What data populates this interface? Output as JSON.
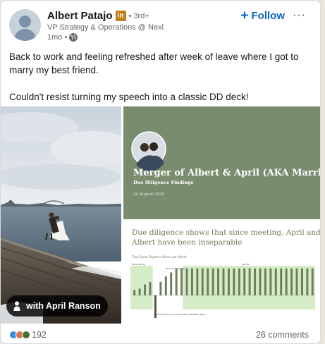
{
  "author": {
    "name": "Albert Patajo",
    "badge": "in",
    "degree": "• 3rd+",
    "headline": "VP Strategy & Operations @ Nexl",
    "time": "1mo •"
  },
  "actions": {
    "follow_label": "Follow",
    "follow_icon": "plus-icon",
    "more_label": "···"
  },
  "post": {
    "line1": "Back to work and feeling refreshed after week of leave where I got to marry my best friend.",
    "line2": "Couldn't resist turning my speech into a classic DD deck!"
  },
  "media": {
    "tag_label": "with April Ranson",
    "slide1": {
      "title": "Merger of Albert & April (AKA Marriage)",
      "subtitle": "Due Diligence Findings",
      "date": "24 August 2025",
      "bg": "#7a8c6e"
    },
    "slide2": {
      "heading": "Due diligence shows that since meeting, April and Albert have been inseparable",
      "chart_title": "Time Spent Together (Hours per Week)",
      "bar_color": "#6e7d5c",
      "highlight_color": "#d4edc7",
      "labels": [
        "Early Dating",
        "Moved in together",
        "Just Me"
      ],
      "footnote": "Albert became pre-occupied with new Netflix game",
      "chart_data": {
        "type": "bar",
        "title": "Time Spent Together (Hours per Week)",
        "values": [
          4,
          5,
          8,
          10,
          -18,
          10,
          14,
          17,
          20,
          20,
          20,
          20,
          20,
          20,
          20,
          20,
          20,
          20,
          20,
          20,
          20,
          20,
          20,
          20,
          20,
          20,
          20,
          20,
          20,
          20,
          20,
          20,
          20,
          20,
          20
        ],
        "ylim": [
          -20,
          24
        ]
      }
    }
  },
  "footer": {
    "reaction_count": "192",
    "comments": "26 comments"
  }
}
